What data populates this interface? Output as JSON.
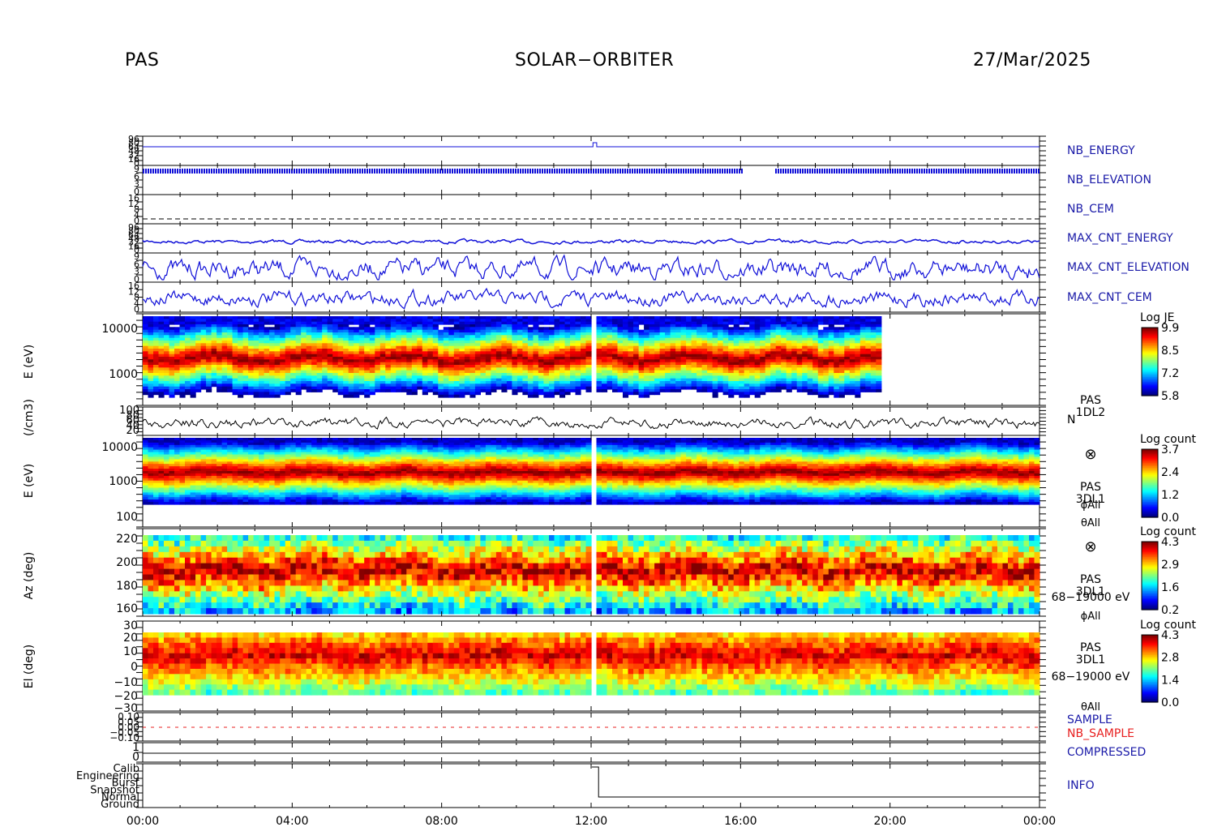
{
  "header": {
    "instrument": "PAS",
    "mission": "SOLAR−ORBITER",
    "date": "27/Mar/2025"
  },
  "colors": {
    "blue_label": "#1a1aa8",
    "red_label": "#e82020",
    "trace_blue": "#1010d8",
    "trace_black": "#000000"
  },
  "time_axis": {
    "ticks": [
      "00:00",
      "04:00",
      "08:00",
      "12:00",
      "16:00",
      "20:00",
      "00:00"
    ],
    "range_hours": [
      0,
      24
    ]
  },
  "chart_data": [
    {
      "type": "line",
      "name_label": "NB_ENERGY",
      "left_ticks": [
        "96",
        "80",
        "64",
        "48",
        "32",
        "16",
        "0"
      ]
    },
    {
      "type": "line",
      "name_label": "NB_ELEVATION",
      "left_ticks": [
        "9",
        "6",
        "3",
        "0"
      ]
    },
    {
      "type": "line",
      "name_label": "NB_CEM",
      "left_ticks": [
        "16",
        "12",
        "8",
        "4",
        "0"
      ]
    },
    {
      "type": "line",
      "name_label": "MAX_CNT_ENERGY",
      "left_ticks": [
        "96",
        "80",
        "64",
        "48",
        "32",
        "16",
        "0"
      ]
    },
    {
      "type": "line",
      "name_label": "MAX_CNT_ELEVATION",
      "left_ticks": [
        "9",
        "6",
        "3",
        "0"
      ]
    },
    {
      "type": "line",
      "name_label": "MAX_CNT_CEM",
      "left_ticks": [
        "16",
        "12",
        "8",
        "4",
        "0"
      ]
    },
    {
      "type": "heatmap",
      "ylabel": "E (eV)",
      "yscale": "log",
      "yticks": [
        "10000",
        "1000"
      ],
      "colorbar": {
        "title": "Log JE",
        "ticks": [
          "9.9",
          "8.5",
          "7.2",
          "5.8"
        ]
      },
      "data_end_hour": 19.8
    },
    {
      "type": "line",
      "ylabel": "(/cm3)",
      "yticks": [
        "100",
        "80",
        "60",
        "40",
        "20"
      ],
      "right_labels": [
        "PAS",
        "1DL2",
        "N"
      ]
    },
    {
      "type": "heatmap",
      "ylabel": "E (eV)",
      "yscale": "log",
      "yticks": [
        "10000",
        "1000",
        "100"
      ],
      "colorbar": {
        "title": "Log count",
        "ticks": [
          "3.7",
          "2.4",
          "1.2",
          "0.0"
        ]
      },
      "right_labels": [
        "⊗",
        "PAS",
        "3DL1",
        "ϕAll",
        "θAll"
      ]
    },
    {
      "type": "heatmap",
      "ylabel": "Az (deg)",
      "yticks": [
        "220",
        "200",
        "180",
        "160"
      ],
      "colorbar": {
        "title": "Log count",
        "ticks": [
          "4.3",
          "2.9",
          "1.6",
          "0.2"
        ]
      },
      "right_labels": [
        "⊗",
        "PAS",
        "3DL1",
        "68−19000 eV",
        "ϕAll"
      ]
    },
    {
      "type": "heatmap",
      "ylabel": "El (deg)",
      "yticks": [
        "30",
        "20",
        "10",
        "0",
        "−10",
        "−20",
        "−30"
      ],
      "colorbar": {
        "title": "Log count",
        "ticks": [
          "4.3",
          "2.8",
          "1.4",
          "0.0"
        ]
      },
      "right_labels": [
        "PAS",
        "3DL1",
        "68−19000 eV",
        "θAll"
      ]
    },
    {
      "type": "line",
      "name_labels": [
        "SAMPLE",
        "NB_SAMPLE"
      ],
      "left_ticks": [
        "0.10",
        "0.05",
        "0.00",
        "−0.05",
        "−0.10"
      ]
    },
    {
      "type": "line",
      "name_label": "COMPRESSED",
      "left_ticks": [
        "1",
        "0"
      ]
    },
    {
      "type": "line",
      "name_label": "INFO",
      "left_ticks": [
        "Calib",
        "Engineering",
        "Burst",
        "Snapshot",
        "Normal",
        "Ground"
      ]
    }
  ]
}
